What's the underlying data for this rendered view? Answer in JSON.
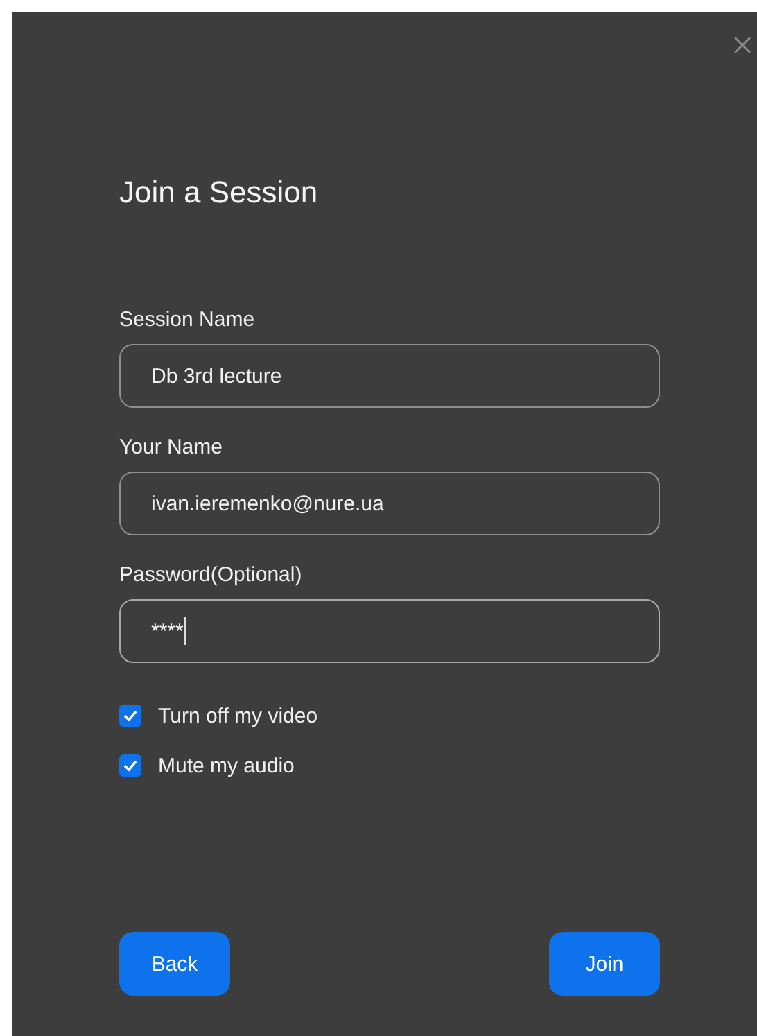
{
  "dialog": {
    "title": "Join a Session"
  },
  "fields": [
    {
      "label": "Session Name",
      "value": "Db 3rd lecture",
      "focused": false
    },
    {
      "label": "Your Name",
      "value": "ivan.ieremenko@nure.ua",
      "focused": false
    },
    {
      "label": "Password(Optional)",
      "value": "****",
      "focused": true
    }
  ],
  "options": [
    {
      "label": "Turn off my video",
      "checked": true
    },
    {
      "label": "Mute my audio",
      "checked": true
    }
  ],
  "buttons": [
    "Back",
    "Join"
  ]
}
